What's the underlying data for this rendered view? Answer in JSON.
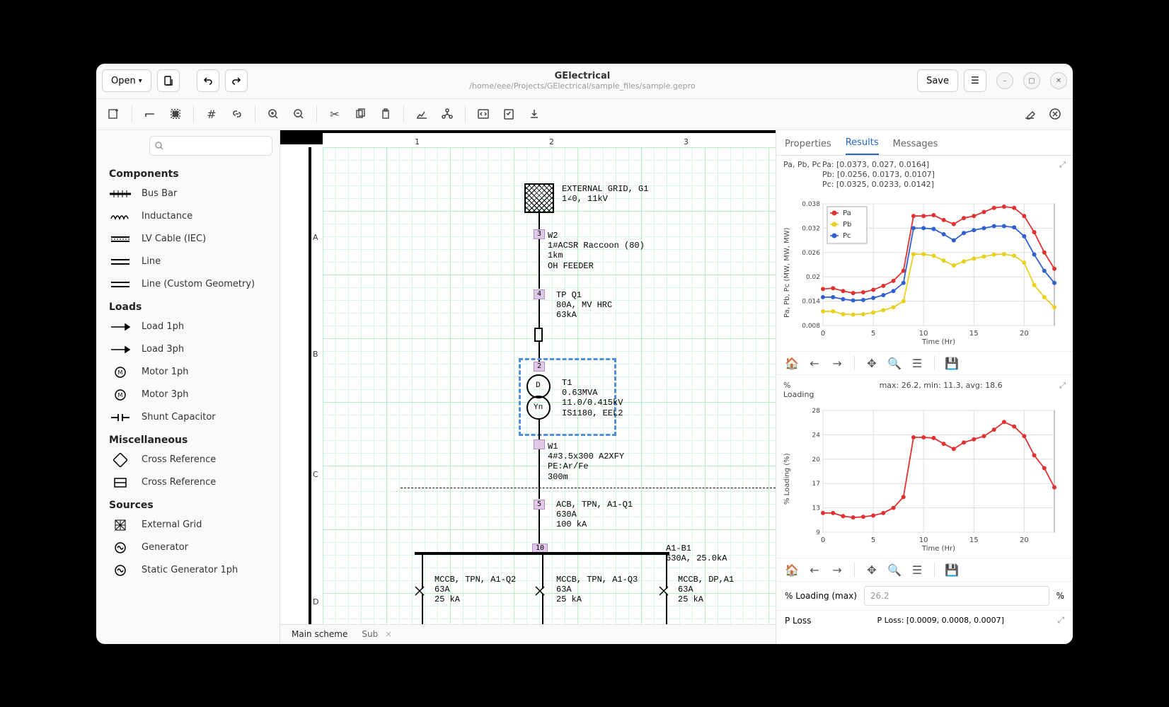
{
  "app": {
    "title": "GElectrical",
    "path": "/home/eee/Projects/GElectrical/sample_files/sample.gepro"
  },
  "titlebar": {
    "open": "Open",
    "save": "Save"
  },
  "sidebar": {
    "search_placeholder": "",
    "sections": {
      "components": "Components",
      "loads": "Loads",
      "misc": "Miscellaneous",
      "sources": "Sources"
    },
    "components": [
      "Bus Bar",
      "Inductance",
      "LV Cable (IEC)",
      "Line",
      "Line (Custom Geometry)"
    ],
    "loads": [
      "Load 1ph",
      "Load 3ph",
      "Motor 1ph",
      "Motor 3ph",
      "Shunt Capacitor"
    ],
    "misc": [
      "Cross Reference",
      "Cross Reference"
    ],
    "sources": [
      "External Grid",
      "Generator",
      "Static Generator 1ph"
    ]
  },
  "canvas": {
    "columns": [
      "1",
      "2",
      "3"
    ],
    "rows": [
      "A",
      "B",
      "C",
      "D"
    ],
    "tabs": {
      "main": "Main scheme",
      "sub": "Sub"
    },
    "texts": {
      "extgrid": "EXTERNAL GRID, G1\n1∠0, 11kV",
      "w2": "W2\n1#ACSR Raccoon (80)\n1km\nOH FEEDER",
      "tpq1": "TP Q1\n80A, MV HRC\n63kA",
      "t1": "T1\n0.63MVA\n11.0/0.415kV\nIS1180, EEL2",
      "w1": "W1\n4#3.5x300 A2XFY\nPE:Ar/Fe\n300m",
      "acb": "ACB, TPN, A1-Q1\n630A\n100 kA",
      "a1b1": "A1-B1\n630A, 25.0kA",
      "mccb1": "MCCB, TPN, A1-Q2\n63A\n25 kA",
      "mccb2": "MCCB, TPN, A1-Q3\n63A\n25 kA",
      "mccb3": "MCCB, DP,A1\n63A\n25 kA",
      "d_label": "D",
      "yn_label": "Yn"
    },
    "nodes": {
      "n3": "3",
      "n4": "4",
      "n2": "2",
      "n5": "5",
      "n10": "10"
    }
  },
  "panel": {
    "tabs": {
      "properties": "Properties",
      "results": "Results",
      "messages": "Messages"
    },
    "chart1": {
      "side_label": "Pa, Pb, Pc",
      "header": "Pa: [0.0373, 0.027, 0.0164]\nPb: [0.0256, 0.0173, 0.0107]\nPc: [0.0325, 0.0233, 0.0142]",
      "ylabel": "Pa, Pb, Pc (MW, MW, MW)",
      "xlabel": "Time (Hr)",
      "legend": [
        "Pa",
        "Pb",
        "Pc"
      ]
    },
    "chart2": {
      "side_label": "% Loading",
      "header": "max: 26.2, min: 11.3, avg: 18.6",
      "ylabel": "% Loading (%)",
      "xlabel": "Time (Hr)"
    },
    "loading_max": {
      "label": "% Loading (max)",
      "value": "26.2",
      "suffix": "%"
    },
    "ploss": {
      "label": "P Loss",
      "text": "P Loss: [0.0009, 0.0008, 0.0007]"
    }
  },
  "chart_data": [
    {
      "type": "line",
      "title": "Pa, Pb, Pc",
      "xlabel": "Time (Hr)",
      "ylabel": "Pa, Pb, Pc (MW, MW, MW)",
      "x": [
        0,
        1,
        2,
        3,
        4,
        5,
        6,
        7,
        8,
        9,
        10,
        11,
        12,
        13,
        14,
        15,
        16,
        17,
        18,
        19,
        20,
        21,
        22,
        23
      ],
      "ylim": [
        0.008,
        0.038
      ],
      "series": [
        {
          "name": "Pa",
          "color": "#e03030",
          "values": [
            0.017,
            0.0172,
            0.0165,
            0.016,
            0.0162,
            0.0168,
            0.0178,
            0.019,
            0.0215,
            0.035,
            0.035,
            0.0352,
            0.034,
            0.033,
            0.0345,
            0.035,
            0.036,
            0.037,
            0.0373,
            0.037,
            0.035,
            0.031,
            0.026,
            0.022
          ]
        },
        {
          "name": "Pb",
          "color": "#e8d020",
          "values": [
            0.0115,
            0.0115,
            0.0108,
            0.0107,
            0.0108,
            0.0112,
            0.0118,
            0.0125,
            0.014,
            0.0256,
            0.0256,
            0.0252,
            0.024,
            0.0228,
            0.0238,
            0.0245,
            0.025,
            0.0255,
            0.0256,
            0.0252,
            0.0235,
            0.018,
            0.015,
            0.0125
          ]
        },
        {
          "name": "Pc",
          "color": "#3060d0",
          "values": [
            0.015,
            0.015,
            0.0145,
            0.0142,
            0.0143,
            0.0148,
            0.0155,
            0.0165,
            0.0185,
            0.032,
            0.032,
            0.0318,
            0.0305,
            0.029,
            0.0308,
            0.0315,
            0.032,
            0.0325,
            0.0325,
            0.0322,
            0.03,
            0.0255,
            0.0215,
            0.0185
          ]
        }
      ]
    },
    {
      "type": "line",
      "title": "% Loading",
      "xlabel": "Time (Hr)",
      "ylabel": "% Loading (%)",
      "x": [
        0,
        1,
        2,
        3,
        4,
        5,
        6,
        7,
        8,
        9,
        10,
        11,
        12,
        13,
        14,
        15,
        16,
        17,
        18,
        19,
        20,
        21,
        22,
        23
      ],
      "ylim": [
        9,
        28
      ],
      "series": [
        {
          "name": "% Loading",
          "color": "#e03030",
          "values": [
            12.0,
            12.0,
            11.5,
            11.3,
            11.4,
            11.6,
            12.0,
            12.8,
            14.5,
            23.8,
            23.8,
            23.7,
            22.8,
            22.0,
            23.0,
            23.5,
            24.0,
            25.0,
            26.2,
            25.5,
            24.0,
            21.0,
            19.0,
            16.0
          ]
        }
      ]
    }
  ]
}
